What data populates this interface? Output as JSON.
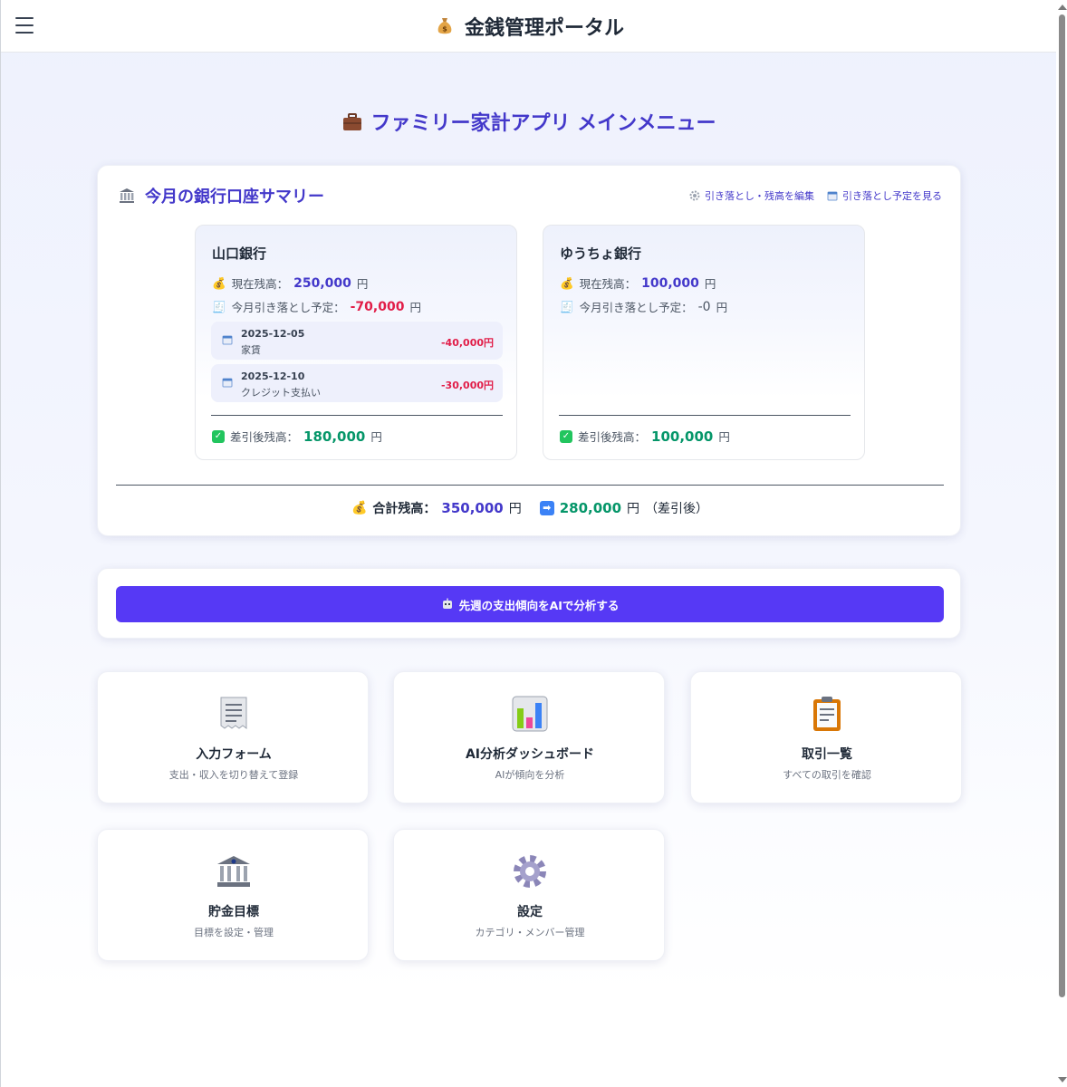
{
  "header": {
    "title": "金銭管理ポータル",
    "icon": "money-bag-icon"
  },
  "page": {
    "heading": "ファミリー家計アプリ メインメニュー"
  },
  "summary": {
    "title": "今月の銀行口座サマリー",
    "edit_link": "引き落とし・残高を編集",
    "schedule_link": "引き落とし予定を見る",
    "banks": [
      {
        "name": "山口銀行",
        "balance_label": "現在残高：",
        "balance": "250,000",
        "debit_label": "今月引き落とし予定：",
        "debit": "-70,000",
        "items": [
          {
            "date": "2025-12-05",
            "desc": "家賃",
            "amount": "-40,000円"
          },
          {
            "date": "2025-12-10",
            "desc": "クレジット支払い",
            "amount": "-30,000円"
          }
        ],
        "after_label": "差引後残高：",
        "after": "180,000"
      },
      {
        "name": "ゆうちょ銀行",
        "balance_label": "現在残高：",
        "balance": "100,000",
        "debit_label": "今月引き落とし予定：",
        "debit": "-0",
        "items": [],
        "after_label": "差引後残高：",
        "after": "100,000"
      }
    ],
    "unit": "円",
    "total_label": "合計残高：",
    "total": "350,000",
    "total_after": "280,000",
    "total_after_suffix": "（差引後）"
  },
  "ai": {
    "button_label": "先週の支出傾向をAIで分析する"
  },
  "menu": [
    {
      "title": "入力フォーム",
      "subtitle": "支出・収入を切り替えて登録",
      "icon": "receipt-icon"
    },
    {
      "title": "AI分析ダッシュボード",
      "subtitle": "AIが傾向を分析",
      "icon": "bar-chart-icon"
    },
    {
      "title": "取引一覧",
      "subtitle": "すべての取引を確認",
      "icon": "clipboard-icon"
    },
    {
      "title": "貯金目標",
      "subtitle": "目標を設定・管理",
      "icon": "bank-icon"
    },
    {
      "title": "設定",
      "subtitle": "カテゴリ・メンバー管理",
      "icon": "gear-icon"
    }
  ],
  "colors": {
    "accent": "#4338ca",
    "button": "#5639f5",
    "negative": "#e11d48",
    "positive": "#059669"
  }
}
